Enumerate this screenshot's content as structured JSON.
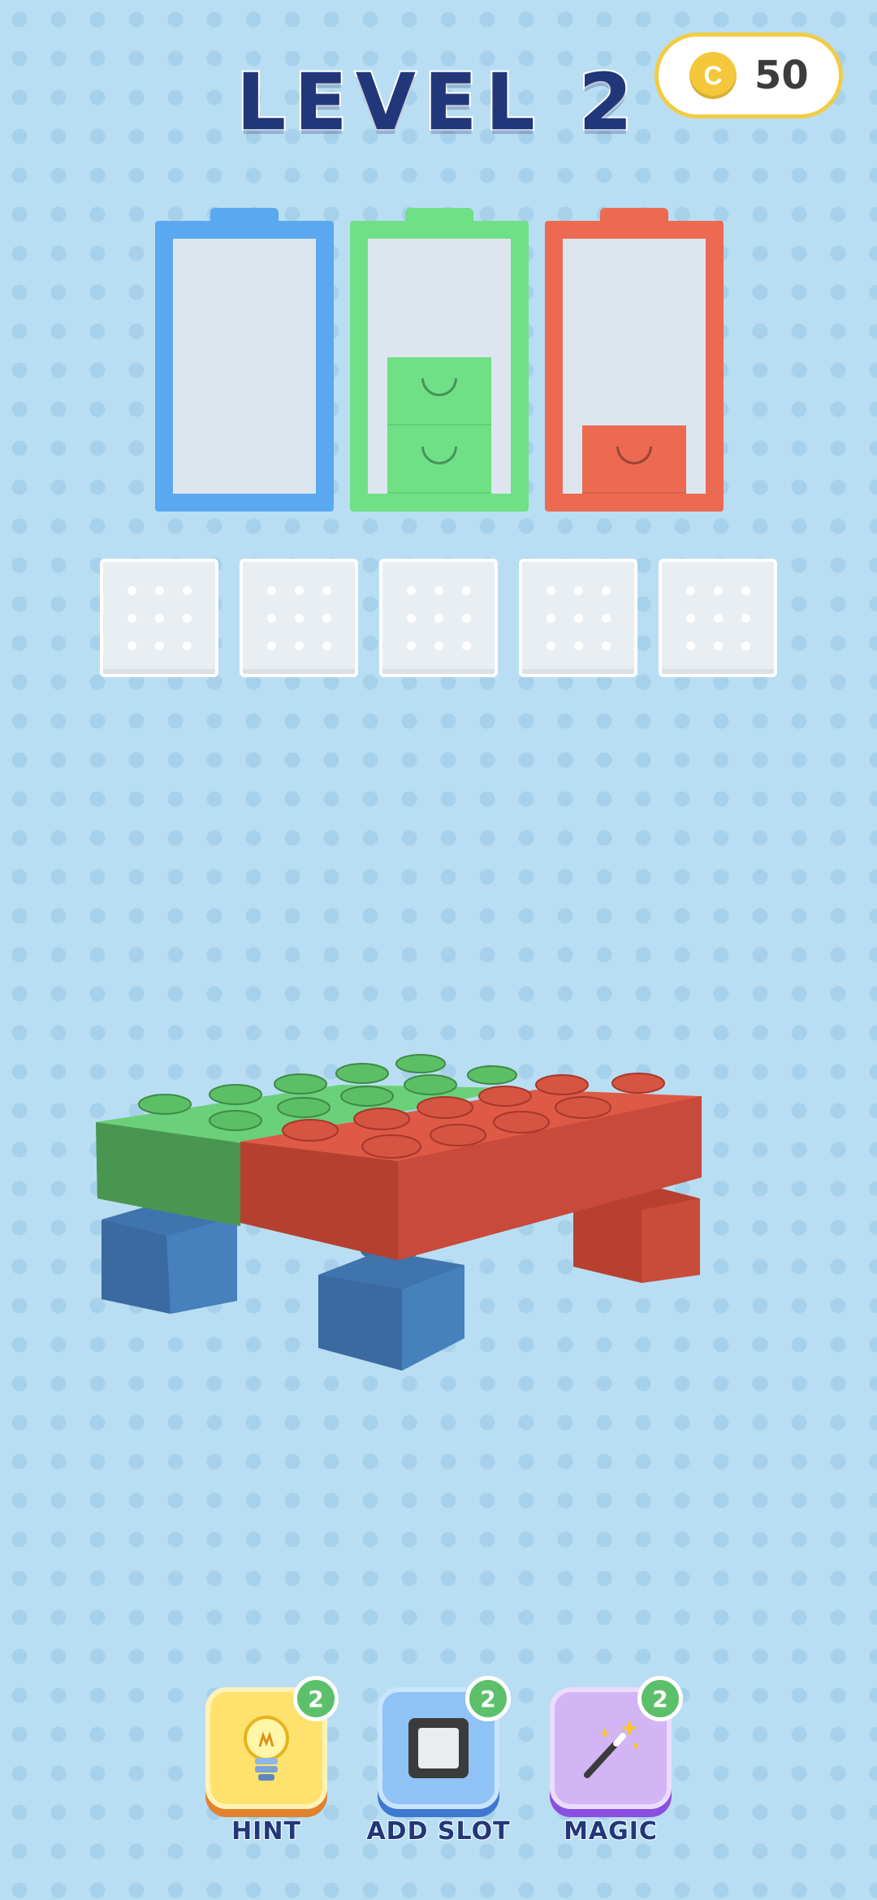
{
  "header": {
    "level_title": "LEVEL 2",
    "coins": {
      "icon": "coin-icon",
      "symbol": "C",
      "value": "50"
    }
  },
  "batteries": [
    {
      "color": "blue",
      "frame_color": "#5aa8f0",
      "bricks": 0
    },
    {
      "color": "green",
      "frame_color": "#6fe086",
      "bricks": 2
    },
    {
      "color": "red",
      "frame_color": "#ec6a52",
      "bricks": 1
    }
  ],
  "slots": {
    "count": 5,
    "filled": 0
  },
  "colors": {
    "blue": "#3f74ad",
    "green": "#4f9e55",
    "red": "#c3473a",
    "accent_title": "#22377a",
    "badge": "#5cc06a"
  },
  "powerups": [
    {
      "id": "hint",
      "label": "HINT",
      "count": "2",
      "icon": "lightbulb-icon"
    },
    {
      "id": "add-slot",
      "label": "ADD SLOT",
      "count": "2",
      "icon": "slot-square-icon"
    },
    {
      "id": "magic",
      "label": "MAGIC",
      "count": "2",
      "icon": "magic-wand-icon"
    }
  ]
}
